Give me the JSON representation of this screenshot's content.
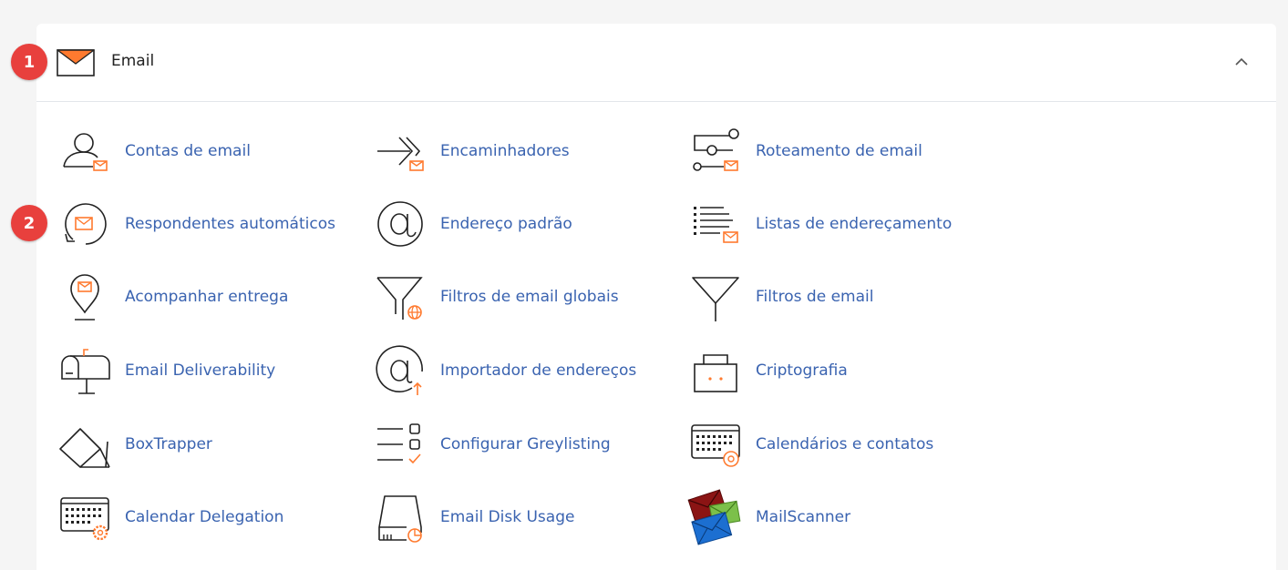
{
  "section": {
    "title": "Email",
    "icon": "envelope-icon",
    "collapse_icon": "chevron-up-icon"
  },
  "badges": [
    "1",
    "2"
  ],
  "colors": {
    "accent": "#ff7a2f",
    "link": "#3a63b0",
    "badge": "#e8403d"
  },
  "tools": [
    {
      "label": "Contas de email",
      "icon": "email-accounts-icon"
    },
    {
      "label": "Encaminhadores",
      "icon": "forwarders-icon"
    },
    {
      "label": "Roteamento de email",
      "icon": "email-routing-icon"
    },
    {
      "label": "Respondentes automáticos",
      "icon": "autoresponders-icon"
    },
    {
      "label": "Endereço padrão",
      "icon": "default-address-icon"
    },
    {
      "label": "Listas de endereçamento",
      "icon": "mailing-lists-icon"
    },
    {
      "label": "Acompanhar entrega",
      "icon": "track-delivery-icon"
    },
    {
      "label": "Filtros de email globais",
      "icon": "global-filters-icon"
    },
    {
      "label": "Filtros de email",
      "icon": "email-filters-icon"
    },
    {
      "label": "Email Deliverability",
      "icon": "mailbox-icon"
    },
    {
      "label": "Importador de endereços",
      "icon": "address-importer-icon"
    },
    {
      "label": "Criptografia",
      "icon": "encryption-icon"
    },
    {
      "label": "BoxTrapper",
      "icon": "boxtrapper-icon"
    },
    {
      "label": "Configurar Greylisting",
      "icon": "greylisting-icon"
    },
    {
      "label": "Calendários e contatos",
      "icon": "calendars-contacts-icon"
    },
    {
      "label": "Calendar Delegation",
      "icon": "calendar-delegation-icon"
    },
    {
      "label": "Email Disk Usage",
      "icon": "disk-usage-icon"
    },
    {
      "label": "MailScanner",
      "icon": "mailscanner-icon"
    }
  ]
}
